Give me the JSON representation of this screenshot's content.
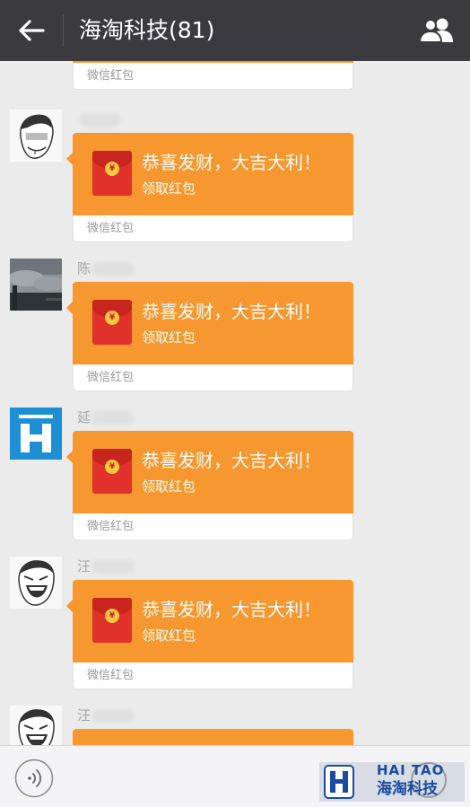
{
  "header": {
    "title": "海淘科技(81)",
    "back_icon": "arrow-left-icon",
    "members_icon": "people-icon"
  },
  "colors": {
    "header_bg": "#3a3a3f",
    "red_packet": "#f7972f",
    "envelope": "#e0312b",
    "chat_bg": "#ebebeb"
  },
  "red_packet": {
    "greeting": "恭喜发财，大吉大利！",
    "action": "领取红包",
    "footer": "微信红包"
  },
  "messages": [
    {
      "sender": "",
      "avatar": "meme-face-avatar"
    },
    {
      "sender": "陈",
      "avatar": "cloudy-sky-avatar"
    },
    {
      "sender": "延",
      "avatar": "letter-h-avatar"
    },
    {
      "sender": "汪",
      "avatar": "laughing-meme-avatar"
    },
    {
      "sender": "汪",
      "avatar": "laughing-meme-avatar"
    }
  ],
  "input": {
    "voice_icon": "voice-icon"
  },
  "watermark": {
    "en": "HAI TAO",
    "cn": "海淘科技"
  }
}
